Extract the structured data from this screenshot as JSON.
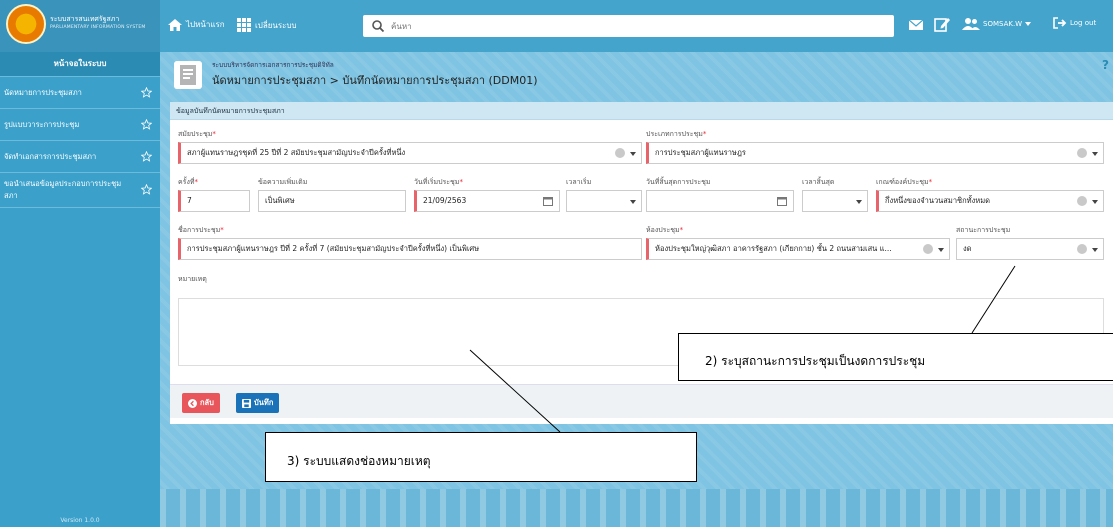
{
  "header": {
    "brand_title": "ระบบสารสนเทศรัฐสภา",
    "brand_subtitle": "PARLIAMENTARY INFORMATION SYSTEM",
    "nav_home": "ไปหน้าแรก",
    "nav_switch_system": "เปลี่ยนระบบ",
    "search_placeholder": "ค้นหา",
    "username": "SOMSAK.W",
    "logout": "Log out",
    "accent_color": "#44a4cc"
  },
  "sidebar": {
    "title": "หน้าจอในระบบ",
    "items": [
      {
        "label": "นัดหมายการประชุมสภา"
      },
      {
        "label": "รูปแบบวาระการประชุม"
      },
      {
        "label": "จัดทำเอกสารการประชุมสภา"
      },
      {
        "label": "ขอนำเสนอข้อมูลประกอบการประชุมสภา"
      }
    ],
    "version": "Version 1.0.0"
  },
  "page": {
    "system_name": "ระบบบริหารจัดการเอกสารการประชุมดิจิทัล",
    "breadcrumb": "นัดหมายการประชุมสภา > บันทึกนัดหมายการประชุมสภา (DDM01)",
    "help": "?"
  },
  "form": {
    "panel_title": "ข้อมูลบันทึกนัดหมายการประชุมสภา",
    "session_label": "สมัยประชุม",
    "session_value": "สภาผู้แทนราษฎรชุดที่ 25 ปีที่ 2 สมัยประชุมสามัญประจำปีครั้งที่หนึ่ง",
    "meeting_type_label": "ประเภทการประชุม",
    "meeting_type_value": "การประชุมสภาผู้แทนราษฎร",
    "round_label": "ครั้งที่",
    "round_value": "7",
    "extra_label": "ข้อความเพิ่มเติม",
    "extra_value": "เป็นพิเศษ",
    "start_date_label": "วันที่เริ่มประชุม",
    "start_date_value": "21/09/2563",
    "start_time_label": "เวลาเริ่ม",
    "end_date_label": "วันที่สิ้นสุดการประชุม",
    "end_time_label": "เวลาสิ้นสุด",
    "quorum_label": "เกณฑ์องค์ประชุม",
    "quorum_value": "กึ่งหนึ่งของจำนวนสมาชิกทั้งหมด",
    "meeting_name_label": "ชื่อการประชุม",
    "meeting_name_value": "การประชุมสภาผู้แทนราษฎร ปีที่ 2 ครั้งที่ 7 (สมัยประชุมสามัญประจำปีครั้งที่หนึ่ง) เป็นพิเศษ",
    "room_label": "ห้องประชุม",
    "room_value": "ห้องประชุมใหญ่วุฒิสภา อาคารรัฐสภา (เกียกกาย) ชั้น 2 ถนนสามเสน แ...",
    "status_label": "สถานะการประชุม",
    "status_value": "งด",
    "remark_label": "หมายเหตุ",
    "remark_value": "",
    "back_button": "กลับ",
    "save_button": "บันทึก"
  },
  "annotations": {
    "callout_2": "2) ระบุสถานะการประชุมเป็นงดการประชุม",
    "callout_3": "3) ระบบแสดงช่องหมายเหตุ"
  }
}
